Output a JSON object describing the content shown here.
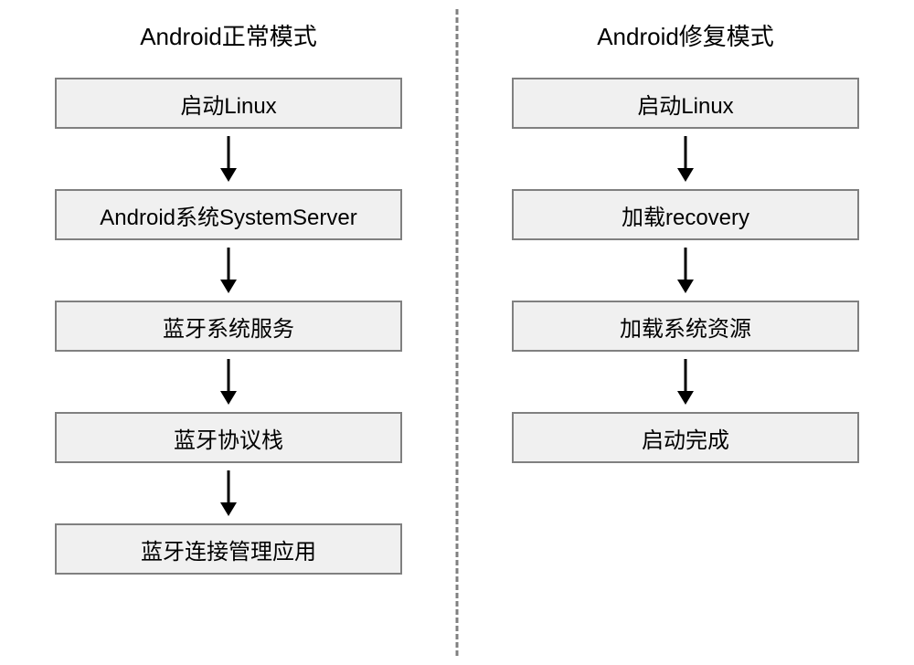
{
  "left": {
    "title": "Android正常模式",
    "steps": [
      "启动Linux",
      "Android系统SystemServer",
      "蓝牙系统服务",
      "蓝牙协议栈",
      "蓝牙连接管理应用"
    ]
  },
  "right": {
    "title": "Android修复模式",
    "steps": [
      "启动Linux",
      "加载recovery",
      "加载系统资源",
      "启动完成"
    ]
  }
}
